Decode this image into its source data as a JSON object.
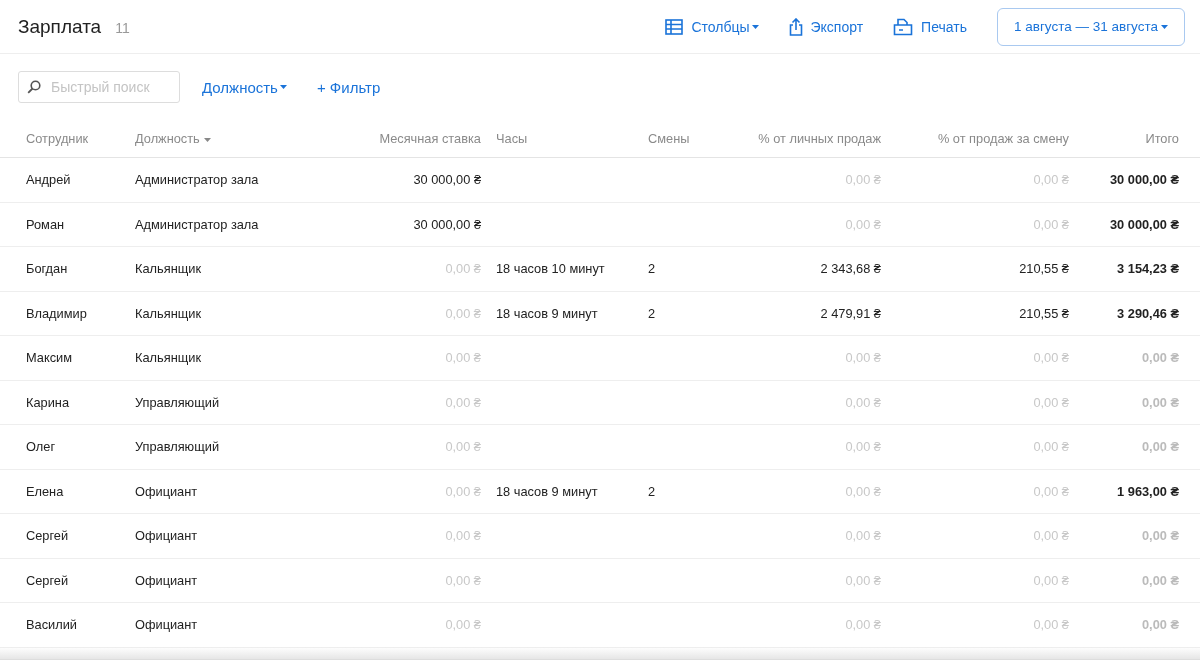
{
  "header": {
    "title": "Зарплата",
    "count": "11",
    "columns_button": "Столбцы",
    "export_button": "Экспорт",
    "print_button": "Печать",
    "date_range": "1 августа — 31 августа"
  },
  "toolbar": {
    "search": {
      "placeholder": "Быстрый поиск"
    },
    "position_filter": "Должность",
    "add_filter": "+ Фильтр"
  },
  "table": {
    "columns": [
      {
        "label": "Сотрудник",
        "sortable": false
      },
      {
        "label": "Должность",
        "sortable": true
      },
      {
        "label": "Месячная ставка",
        "sortable": false
      },
      {
        "label": "Часы",
        "sortable": false
      },
      {
        "label": "Смены",
        "sortable": false
      },
      {
        "label": "% от личных продаж",
        "sortable": false
      },
      {
        "label": "% от продаж за смену",
        "sortable": false
      },
      {
        "label": "Итого",
        "sortable": false
      }
    ],
    "rows": [
      {
        "employee": "Андрей",
        "position": "Администратор зала",
        "rate": {
          "value": "30 000,00 ₴",
          "muted": false
        },
        "hours": "",
        "shifts": "",
        "personal": {
          "value": "0,00 ₴",
          "muted": true
        },
        "per_shift": {
          "value": "0,00 ₴",
          "muted": true
        },
        "total": {
          "value": "30 000,00 ₴",
          "muted": false
        }
      },
      {
        "employee": "Роман",
        "position": "Администратор зала",
        "rate": {
          "value": "30 000,00 ₴",
          "muted": false
        },
        "hours": "",
        "shifts": "",
        "personal": {
          "value": "0,00 ₴",
          "muted": true
        },
        "per_shift": {
          "value": "0,00 ₴",
          "muted": true
        },
        "total": {
          "value": "30 000,00 ₴",
          "muted": false
        }
      },
      {
        "employee": "Богдан",
        "position": "Кальянщик",
        "rate": {
          "value": "0,00 ₴",
          "muted": true
        },
        "hours": "18 часов 10 минут",
        "shifts": "2",
        "personal": {
          "value": "2 343,68 ₴",
          "muted": false
        },
        "per_shift": {
          "value": "210,55 ₴",
          "muted": false
        },
        "total": {
          "value": "3 154,23 ₴",
          "muted": false
        }
      },
      {
        "employee": "Владимир",
        "position": "Кальянщик",
        "rate": {
          "value": "0,00 ₴",
          "muted": true
        },
        "hours": "18 часов 9 минут",
        "shifts": "2",
        "personal": {
          "value": "2 479,91 ₴",
          "muted": false
        },
        "per_shift": {
          "value": "210,55 ₴",
          "muted": false
        },
        "total": {
          "value": "3 290,46 ₴",
          "muted": false
        }
      },
      {
        "employee": "Максим",
        "position": "Кальянщик",
        "rate": {
          "value": "0,00 ₴",
          "muted": true
        },
        "hours": "",
        "shifts": "",
        "personal": {
          "value": "0,00 ₴",
          "muted": true
        },
        "per_shift": {
          "value": "0,00 ₴",
          "muted": true
        },
        "total": {
          "value": "0,00 ₴",
          "muted": true
        }
      },
      {
        "employee": "Карина",
        "position": "Управляющий",
        "rate": {
          "value": "0,00 ₴",
          "muted": true
        },
        "hours": "",
        "shifts": "",
        "personal": {
          "value": "0,00 ₴",
          "muted": true
        },
        "per_shift": {
          "value": "0,00 ₴",
          "muted": true
        },
        "total": {
          "value": "0,00 ₴",
          "muted": true
        }
      },
      {
        "employee": "Олег",
        "position": "Управляющий",
        "rate": {
          "value": "0,00 ₴",
          "muted": true
        },
        "hours": "",
        "shifts": "",
        "personal": {
          "value": "0,00 ₴",
          "muted": true
        },
        "per_shift": {
          "value": "0,00 ₴",
          "muted": true
        },
        "total": {
          "value": "0,00 ₴",
          "muted": true
        }
      },
      {
        "employee": "Елена",
        "position": "Официант",
        "rate": {
          "value": "0,00 ₴",
          "muted": true
        },
        "hours": "18 часов 9 минут",
        "shifts": "2",
        "personal": {
          "value": "0,00 ₴",
          "muted": true
        },
        "per_shift": {
          "value": "0,00 ₴",
          "muted": true
        },
        "total": {
          "value": "1 963,00 ₴",
          "muted": false
        }
      },
      {
        "employee": "Сергей",
        "position": "Официант",
        "rate": {
          "value": "0,00 ₴",
          "muted": true
        },
        "hours": "",
        "shifts": "",
        "personal": {
          "value": "0,00 ₴",
          "muted": true
        },
        "per_shift": {
          "value": "0,00 ₴",
          "muted": true
        },
        "total": {
          "value": "0,00 ₴",
          "muted": true
        }
      },
      {
        "employee": "Сергей",
        "position": "Официант",
        "rate": {
          "value": "0,00 ₴",
          "muted": true
        },
        "hours": "",
        "shifts": "",
        "personal": {
          "value": "0,00 ₴",
          "muted": true
        },
        "per_shift": {
          "value": "0,00 ₴",
          "muted": true
        },
        "total": {
          "value": "0,00 ₴",
          "muted": true
        }
      },
      {
        "employee": "Василий",
        "position": "Официант",
        "rate": {
          "value": "0,00 ₴",
          "muted": true
        },
        "hours": "",
        "shifts": "",
        "personal": {
          "value": "0,00 ₴",
          "muted": true
        },
        "per_shift": {
          "value": "0,00 ₴",
          "muted": true
        },
        "total": {
          "value": "0,00 ₴",
          "muted": true
        }
      }
    ]
  }
}
